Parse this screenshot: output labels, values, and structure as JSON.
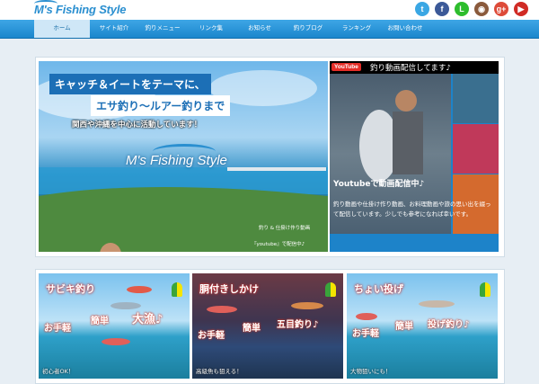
{
  "header": {
    "logo": "M's Fishing Style",
    "social": [
      {
        "name": "twitter-icon",
        "glyph": "t",
        "color": "#3aa7e4"
      },
      {
        "name": "facebook-icon",
        "glyph": "f",
        "color": "#3b5998"
      },
      {
        "name": "line-icon",
        "glyph": "L",
        "color": "#2dbd2d"
      },
      {
        "name": "instagram-icon",
        "glyph": "◉",
        "color": "#8a5a3c"
      },
      {
        "name": "google-plus-icon",
        "glyph": "g+",
        "color": "#dd4b39"
      },
      {
        "name": "youtube-icon",
        "glyph": "▶",
        "color": "#d02b25"
      }
    ]
  },
  "nav": {
    "items": [
      "ホーム",
      "サイト紹介",
      "釣りメニュー",
      "リンク集",
      "お知らせ",
      "釣りブログ",
      "ランキング",
      "お問い合わせ"
    ]
  },
  "hero": {
    "line1": "キャッチ＆イートをテーマに、",
    "line2": "エサ釣り〜ルアー釣りまで",
    "line3": "関西や沖縄を中心に活動しています！",
    "logo": "M's Fishing Style",
    "caption1": "釣り & 仕掛け作り動画",
    "caption2": "『youtube』で配信中♪"
  },
  "youtube": {
    "badge": "YouTube",
    "title": "釣り動画配信してます♪",
    "subtitle": "Youtubeで動画配信中♪",
    "desc": "釣り動画や仕掛け作り動画、お料理動画や旅の思い出を綴って配信しています。少しでも参考になれば幸いです。"
  },
  "cards": [
    {
      "title": "サビキ釣り",
      "tags": [
        "お手軽",
        "簡単",
        "大漁♪"
      ],
      "caption": "初心者OK！"
    },
    {
      "title": "胴付きしかけ",
      "tags": [
        "お手軽",
        "簡単",
        "五目釣り♪"
      ],
      "caption": "高級魚も狙える！"
    },
    {
      "title": "ちょい投げ",
      "tags": [
        "お手軽",
        "簡単",
        "投げ釣り♪"
      ],
      "caption": "大物狙いにも！"
    }
  ]
}
